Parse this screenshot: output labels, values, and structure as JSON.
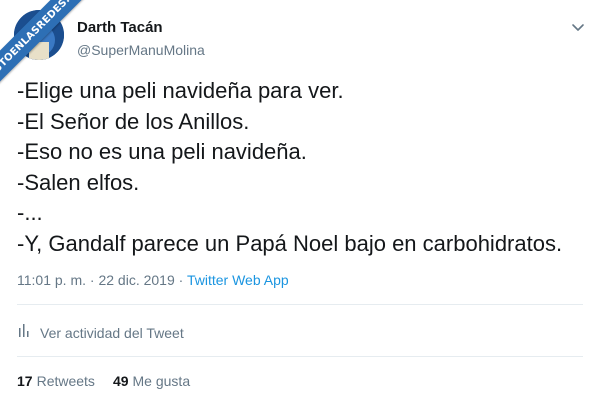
{
  "watermark": {
    "text": "VISTOENLASREDES.COM"
  },
  "author": {
    "display_name": "Darth Tacán",
    "handle": "@SuperManuMolina"
  },
  "icons": {
    "caret": "chevron-down-icon",
    "activity": "bar-chart-icon"
  },
  "tweet": {
    "lines": [
      "-Elige una peli navideña para ver.",
      "-El Señor de los Anillos.",
      "-Eso no es una peli navideña.",
      "-Salen elfos.",
      "-...",
      "-Y, Gandalf parece un Papá Noel bajo en carbohidratos."
    ],
    "time": "11:01 p. m.",
    "separator": "·",
    "date": "22 dic. 2019",
    "source": "Twitter Web App"
  },
  "activity_link": {
    "label": "Ver actividad del Tweet"
  },
  "stats": {
    "retweets_count": "17",
    "retweets_label": "Retweets",
    "likes_count": "49",
    "likes_label": "Me gusta"
  },
  "colors": {
    "text": "#14171a",
    "secondary": "#657786",
    "link": "#1b95e0",
    "divider": "#e6ecf0",
    "watermark": "#2d6fb5"
  }
}
